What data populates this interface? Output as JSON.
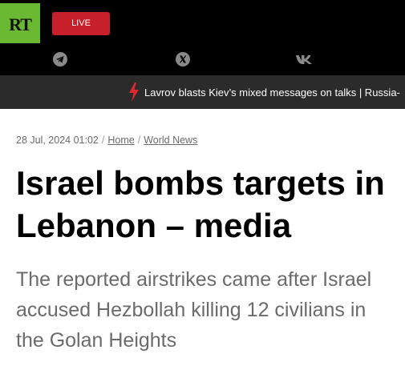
{
  "header": {
    "logo_text": "RT",
    "live_label": "LIVE",
    "social_icons": [
      "telegram-icon",
      "x-icon",
      "vk-icon"
    ]
  },
  "ticker": {
    "text": "Lavrov blasts Kiev’s mixed messages on talks | Russia-"
  },
  "article": {
    "date": "28 Jul, 2024 01:02",
    "breadcrumb": [
      {
        "label": "Home"
      },
      {
        "label": "World News"
      }
    ],
    "headline": "Israel bombs targets in Lebanon – media",
    "summary": "The reported airstrikes came after Israel accused Hezbollah killing 12 civilians in the Golan Heights"
  },
  "colors": {
    "logo_green": "#6bb832",
    "live_red": "#c8202a",
    "bolt_red": "#e0262e",
    "ticker_bg": "#2b2b2b"
  }
}
